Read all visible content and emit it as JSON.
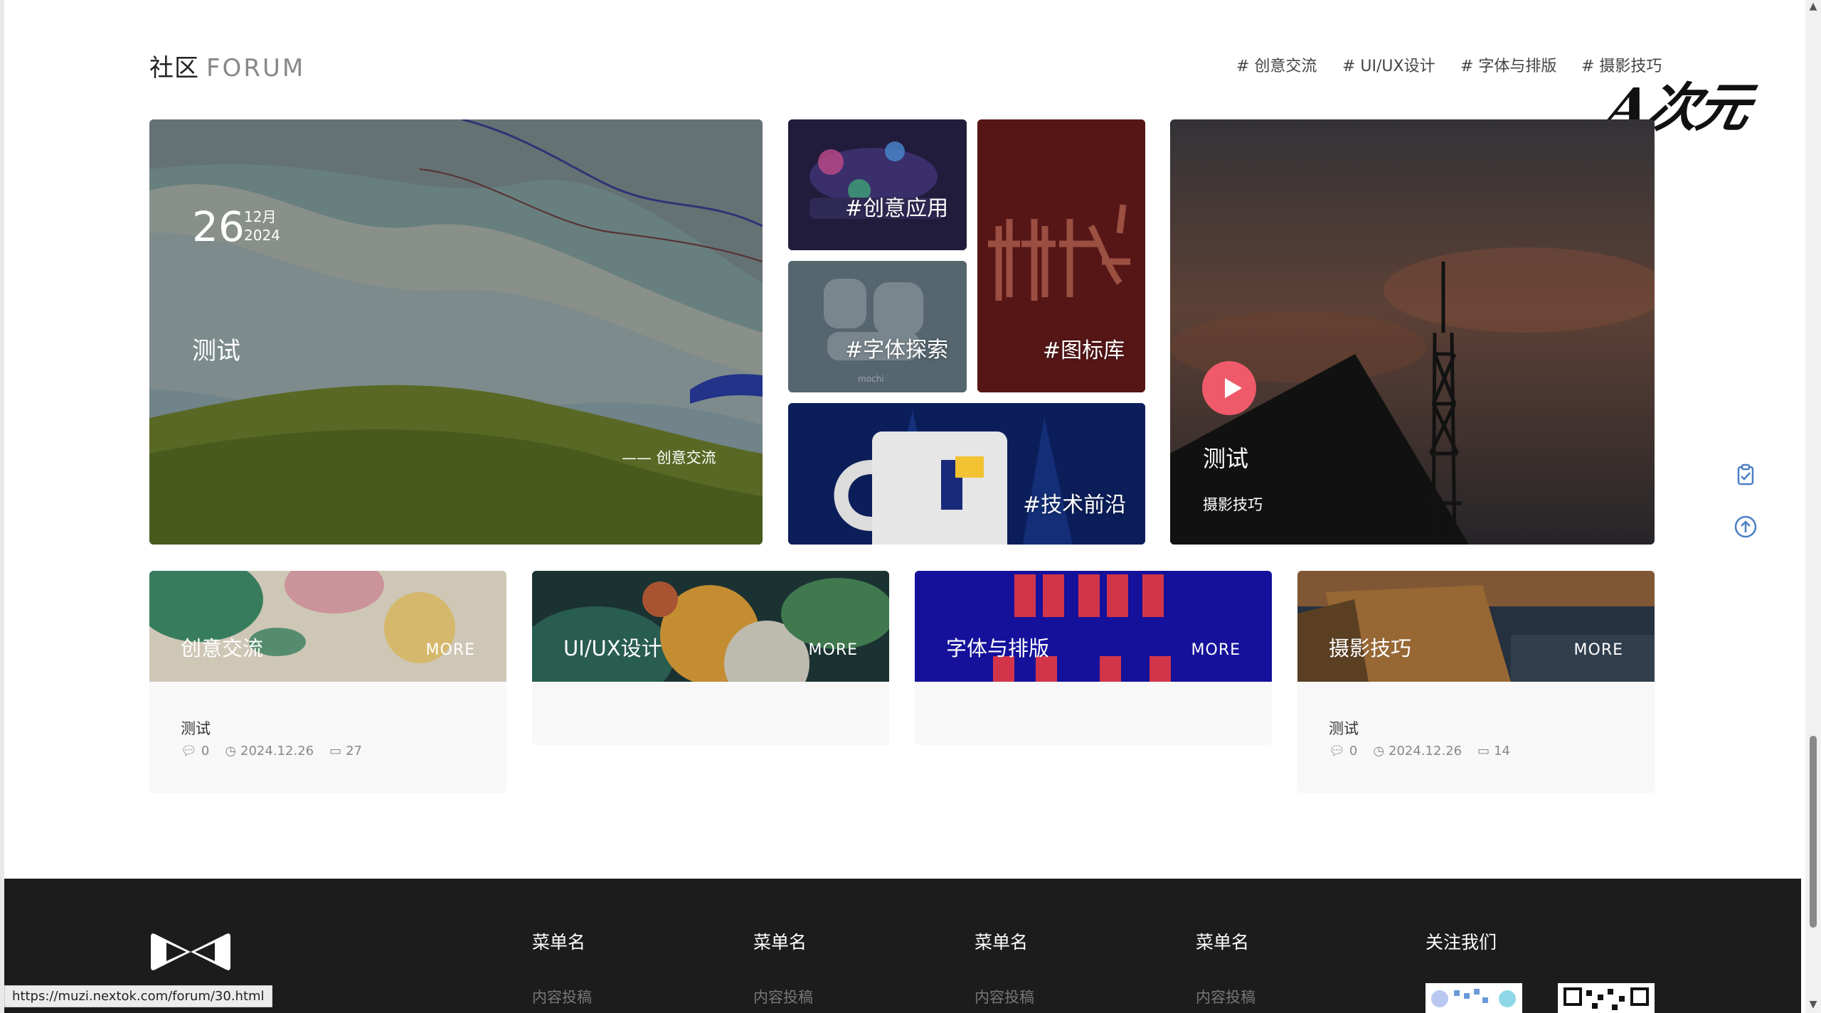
{
  "forum": {
    "title_cn": "社区",
    "title_en": "FORUM",
    "tags": [
      "# 创意交流",
      "# UI/UX设计",
      "# 字体与排版",
      "# 摄影技巧"
    ],
    "logo_text": "A次元"
  },
  "featured": {
    "day": "26",
    "month": "12月",
    "year": "2024",
    "title": "测试",
    "category": "—— 创意交流"
  },
  "tiles": [
    {
      "label": "#创意应用"
    },
    {
      "label": "#图标库"
    },
    {
      "label": "#字体探索"
    },
    {
      "label": "#技术前沿"
    }
  ],
  "video": {
    "title": "测试",
    "category": "摄影技巧"
  },
  "categories": [
    {
      "name": "创意交流",
      "more": "MORE",
      "post": {
        "title": "测试",
        "comments": "0",
        "date": "2024.12.26",
        "views": "27"
      }
    },
    {
      "name": "UI/UX设计",
      "more": "MORE"
    },
    {
      "name": "字体与排版",
      "more": "MORE"
    },
    {
      "name": "摄影技巧",
      "more": "MORE",
      "post": {
        "title": "测试",
        "comments": "0",
        "date": "2024.12.26",
        "views": "14"
      }
    }
  ],
  "footer": {
    "menus": [
      {
        "head": "菜单名",
        "item": "内容投稿"
      },
      {
        "head": "菜单名",
        "item": "内容投稿"
      },
      {
        "head": "菜单名",
        "item": "内容投稿"
      },
      {
        "head": "菜单名",
        "item": "内容投稿"
      }
    ],
    "follow": "关注我们"
  },
  "status_url": "https://muzi.nextok.com/forum/30.html",
  "colors": {
    "accent": "#ef5a6a",
    "footer_bg": "#1c1c1c",
    "tile_blue": "#0d1f5c",
    "tile_red": "#5a1717"
  }
}
